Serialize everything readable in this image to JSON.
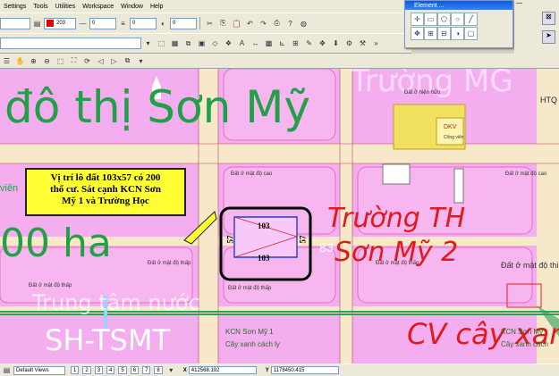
{
  "menu": [
    "Settings",
    "Tools",
    "Utilities",
    "Workspace",
    "Window",
    "Help"
  ],
  "toolbar": {
    "color_value": "203",
    "level_value": "0",
    "weight_value": "0",
    "style_value": "0"
  },
  "element_panel": {
    "title": "Element ..."
  },
  "status_bar": {
    "page_tabs": [
      "1",
      "2",
      "3",
      "4",
      "5",
      "6",
      "7",
      "8"
    ],
    "view": "Default Views",
    "x_label": "X",
    "x_value": "412568.192",
    "y_label": "Y",
    "y_value": "1178450.415"
  },
  "map": {
    "title_large": "đô thị Sơn Mỹ",
    "left_large": "00 ha",
    "bottom_large": "SH-TSMT",
    "watermark_text": "Trung tâm nước",
    "top_red_text": "Trường MG",
    "school_red_line1": "Trường TH",
    "school_red_line2": "Sơn Mỹ 2",
    "park_red_text": "CV cây xan",
    "dim_top": "103",
    "dim_bottom": "103",
    "dim_left": "57",
    "dim_right": "57",
    "label_vien": "viên",
    "label_dat_o_hien_huu": "Đất ở hiện hữu",
    "label_dat_o_mat_do_cao_1": "Đất ở mật độ cao",
    "label_dat_o_mat_do_cao_2": "Đất ở mật độ cao",
    "label_dat_o_mat_do_thap_1": "Đất ở mật độ thấp",
    "label_dat_o_mat_do_thap_2": "Đất ở mật độ thấp",
    "label_dat_o_mat_do_thap_3": "Đất ở mật độ thấp",
    "label_dat_o_mat_do_thap_4": "Đất ở mật độ thấp",
    "label_dat_o_mat_do_thi": "Đất ở mật độ thi",
    "label_dkv": "DKV",
    "label_cong_vien": "Công viên",
    "label_kcn_1": "KCN Sơn Mỹ 1",
    "label_cay_xanh_1": "Cây xanh cách ly",
    "label_kcn_2": "KCN Sơn Mỹ",
    "label_cay_xanh_2": "Cây xanh cách",
    "label_htqt": "HTQ",
    "label_83": "83"
  },
  "callout": {
    "line1": "Vị trí lô đất 103x57 có 200",
    "line2": "thổ cư. Sát cạnh KCN Sơn",
    "line3": "Mỹ 1 và Trường Học"
  }
}
